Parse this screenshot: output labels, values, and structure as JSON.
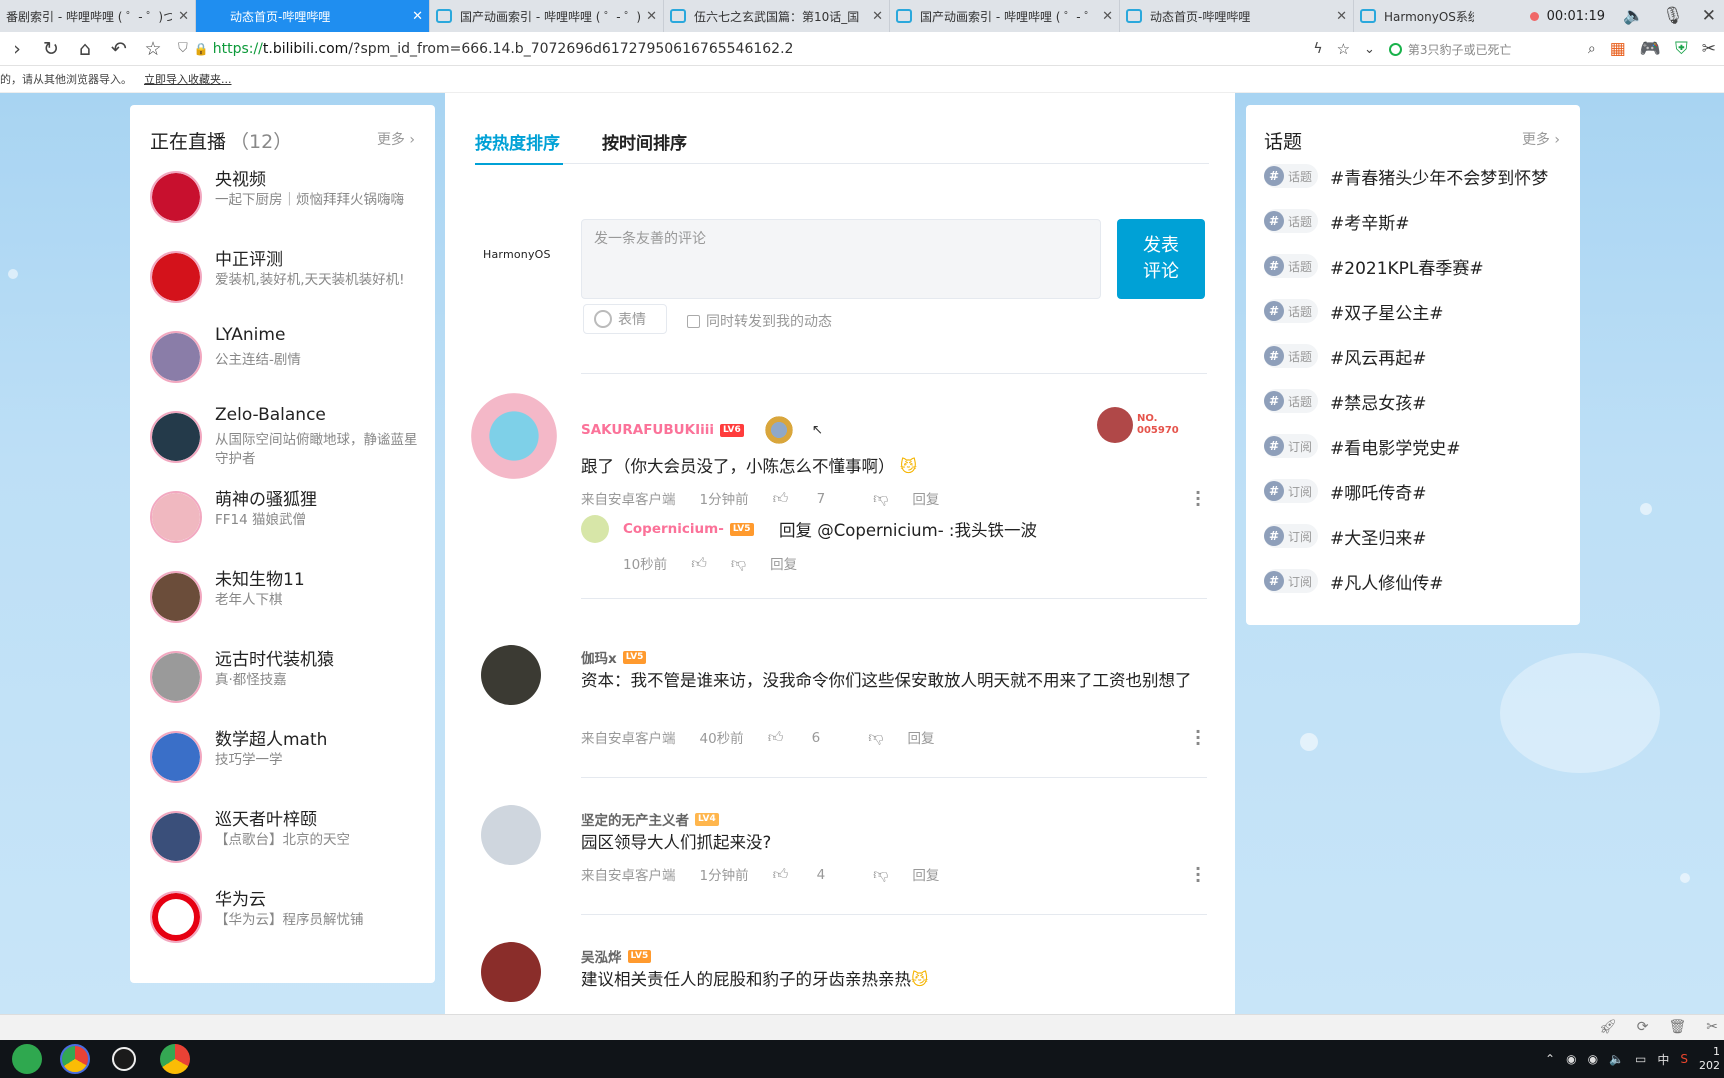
{
  "browser": {
    "tabs": [
      {
        "title": "番剧索引 - 哔哩哔哩 ( ゜- ゜)つロ 干杯",
        "active": false
      },
      {
        "title": "动态首页-哔哩哔哩",
        "active": true
      },
      {
        "title": "国产动画索引 - 哔哩哔哩 ( ゜- ゜)つロ",
        "active": false
      },
      {
        "title": "伍六七之玄武国篇：第10话_国",
        "active": false
      },
      {
        "title": "国产动画索引 - 哔哩哔哩 ( ゜- ゜)",
        "active": false
      },
      {
        "title": "动态首页-哔哩哔哩",
        "active": false
      },
      {
        "title": "HarmonyOS系统的个",
        "active": false
      }
    ],
    "recording_time": "00:01:19",
    "url_scheme": "https://",
    "url_domain": "t.bilibili.com",
    "url_path": "/?spm_id_from=666.14.b_7072696d61727950616765546162.2",
    "search_placeholder": "第3只豹子或已死亡",
    "bookmark_notice": "的，请从其他浏览器导入。",
    "bookmark_link": "立即导入收藏夹..."
  },
  "live": {
    "title": "正在直播",
    "count": "（12）",
    "more": "更多",
    "items": [
      {
        "name": "央视频",
        "desc": "一起下厨房｜烦恼拜拜火锅嗨嗨",
        "color": "#c8102e"
      },
      {
        "name": "中正评测",
        "desc": "爱装机,装好机,天天装机装好机!",
        "color": "#d4121b"
      },
      {
        "name": "LYAnime",
        "desc": "公主连结-剧情",
        "color": "#8a7da8"
      },
      {
        "name": "Zelo-Balance",
        "desc": "从国际空间站俯瞰地球，静谧蓝星守护者",
        "color": "#243a4a"
      },
      {
        "name": "萌神の骚狐狸",
        "desc": "FF14 猫娘武僧",
        "color": "#f0b8c0"
      },
      {
        "name": "未知生物11",
        "desc": "老年人下棋",
        "color": "#6b4d3a"
      },
      {
        "name": "远古时代装机猿",
        "desc": "真·都怪技嘉",
        "color": "#9a9a9a"
      },
      {
        "name": "数学超人math",
        "desc": "技巧学一学",
        "color": "#3a6fc8"
      },
      {
        "name": "巡天者叶梓颐",
        "desc": "【点歌台】北京的天空",
        "color": "#3a4f7a"
      },
      {
        "name": "华为云",
        "desc": "【华为云】程序员解忧铺",
        "color": "#e60012"
      }
    ]
  },
  "feed": {
    "sort_hot": "按热度排序",
    "sort_time": "按时间排序",
    "logo_text": "HarmonyOS",
    "comment_placeholder": "发一条友善的评论",
    "send_label": "发表\n评论",
    "emoji_label": "表情",
    "forward_label": "同时转发到我的动态",
    "comments": [
      {
        "user": "SAKURAFUBUKIiii",
        "level": "LV6",
        "user_color": "#fb7299",
        "lv_color": "#ff3c3c",
        "badge": "NO. 005970",
        "text": "跟了（你大会员没了，小陈怎么不懂事啊）",
        "source": "来自安卓客户端",
        "time": "1分钟前",
        "likes": "7",
        "reply": "回复",
        "avatar_color": "#f2b8c8",
        "sub": {
          "user": "Copernicium-",
          "level": "LV5",
          "text": "回复 @Copernicium- :我头铁一波",
          "time": "10秒前",
          "reply": "回复"
        }
      },
      {
        "user": "伽玛x",
        "level": "LV5",
        "user_color": "#666",
        "lv_color": "#ff9a2e",
        "text": "资本：我不管是谁来访，没我命令你们这些保安敢放人明天就不用来了工资也别想了",
        "source": "来自安卓客户端",
        "time": "40秒前",
        "likes": "6",
        "reply": "回复",
        "avatar_color": "#3b3a33"
      },
      {
        "user": "坚定的无产主义者",
        "level": "LV4",
        "user_color": "#666",
        "lv_color": "#ffb64d",
        "text": "园区领导大人们抓起来没?",
        "source": "来自安卓客户端",
        "time": "1分钟前",
        "likes": "4",
        "reply": "回复",
        "avatar_color": "#cfd6de"
      },
      {
        "user": "吴泓烨",
        "level": "LV5",
        "user_color": "#666",
        "lv_color": "#ff9a2e",
        "text": "建议相关责任人的屁股和豹子的牙齿亲热亲热",
        "avatar_color": "#8a2d2a"
      }
    ]
  },
  "topics": {
    "title": "话题",
    "more": "更多",
    "items": [
      {
        "tag": "话题",
        "name": "#青春猪头少年不会梦到怀梦"
      },
      {
        "tag": "话题",
        "name": "#考辛斯#"
      },
      {
        "tag": "话题",
        "name": "#2021KPL春季赛#"
      },
      {
        "tag": "话题",
        "name": "#双子星公主#"
      },
      {
        "tag": "话题",
        "name": "#风云再起#"
      },
      {
        "tag": "话题",
        "name": "#禁忌女孩#"
      },
      {
        "tag": "订阅",
        "name": "#看电影学党史#"
      },
      {
        "tag": "订阅",
        "name": "#哪吒传奇#"
      },
      {
        "tag": "订阅",
        "name": "#大圣归来#"
      },
      {
        "tag": "订阅",
        "name": "#凡人修仙传#"
      }
    ]
  },
  "taskbar": {
    "ime": "中",
    "clock_time": "1",
    "clock_date": "202"
  }
}
